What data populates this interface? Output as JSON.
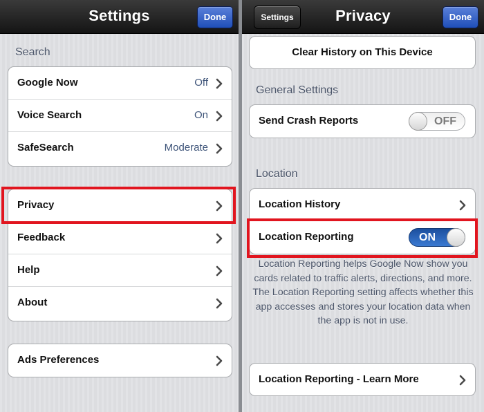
{
  "left": {
    "title": "Settings",
    "done_label": "Done",
    "search_header": "Search",
    "search_items": [
      {
        "label": "Google Now",
        "value": "Off"
      },
      {
        "label": "Voice Search",
        "value": "On"
      },
      {
        "label": "SafeSearch",
        "value": "Moderate"
      }
    ],
    "menu_items": [
      {
        "label": "Privacy"
      },
      {
        "label": "Feedback"
      },
      {
        "label": "Help"
      },
      {
        "label": "About"
      }
    ],
    "ads_item": {
      "label": "Ads Preferences"
    }
  },
  "right": {
    "title": "Privacy",
    "back_label": "Settings",
    "done_label": "Done",
    "clear_history_label": "Clear History on This Device",
    "general_header": "General Settings",
    "crash_reports": {
      "label": "Send Crash Reports",
      "toggle": "OFF"
    },
    "location_header": "Location",
    "location_history_label": "Location History",
    "location_reporting": {
      "label": "Location Reporting",
      "toggle": "ON"
    },
    "location_note": "Location Reporting helps Google Now show you cards related to traffic alerts, directions, and more.  The Location Reporting setting affects whether this app accesses and stores your location data when the app is not in use.",
    "learn_more_label": "Location Reporting - Learn More"
  },
  "colors": {
    "highlight": "#e1151f",
    "done_button": "#1f4fb8",
    "toggle_on": "#2a63b8",
    "section_header_text": "#4c566a",
    "detail_value_text": "#3e5479"
  },
  "icons": {
    "chevron": "chevron-right-icon"
  }
}
